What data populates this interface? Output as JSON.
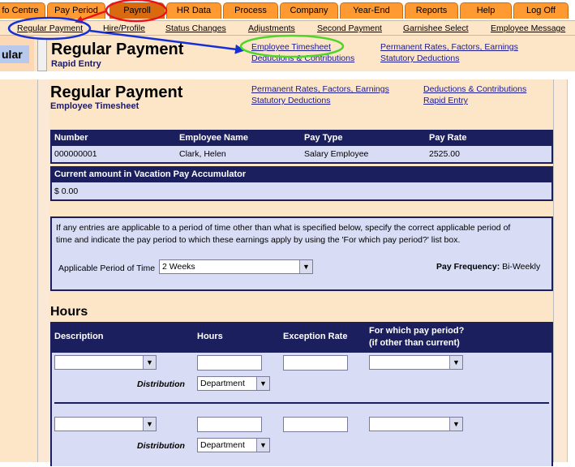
{
  "tabs": [
    {
      "label": "fo Centre",
      "active": false
    },
    {
      "label": "Pay Period",
      "active": false
    },
    {
      "label": "Payroll",
      "active": true
    },
    {
      "label": "HR Data",
      "active": false
    },
    {
      "label": "Process",
      "active": false
    },
    {
      "label": "Company",
      "active": false
    },
    {
      "label": "Year-End",
      "active": false
    },
    {
      "label": "Reports",
      "active": false
    },
    {
      "label": "Help",
      "active": false
    },
    {
      "label": "Log Off",
      "active": false
    }
  ],
  "subnav": [
    "Regular Payment",
    "Hire/Profile",
    "Status Changes",
    "Adjustments",
    "Second Payment",
    "Garnishee Select",
    "Employee Message"
  ],
  "top_page": {
    "side_label": "ular",
    "title": "Regular Payment",
    "subtitle": "Rapid Entry",
    "links": [
      "Employee Timesheet",
      "Deductions & Contributions",
      "Permanent Rates, Factors, Earnings",
      "Statutory Deductions"
    ]
  },
  "page": {
    "title": "Regular Payment",
    "subtitle": "Employee Timesheet",
    "links": [
      "Permanent Rates, Factors, Earnings",
      "Statutory Deductions",
      "Deductions & Contributions",
      "Rapid Entry"
    ]
  },
  "employee_table": {
    "headers": [
      "Number",
      "Employee Name",
      "Pay Type",
      "Pay Rate"
    ],
    "row": [
      "000000001",
      "Clark, Helen",
      "Salary Employee",
      "2525.00"
    ]
  },
  "vacation": {
    "header": "Current amount in Vacation Pay Accumulator",
    "value": "$ 0.00"
  },
  "period": {
    "info_line1": "If any entries are applicable to a period of time other than what is specified below, specify the correct applicable period of",
    "info_line2": "time and indicate the pay period to which these earnings apply by using the 'For which pay period?' list box.",
    "label": "Applicable Period of Time",
    "selected": "2 Weeks",
    "freq_label": "Pay Frequency:",
    "freq_value": "Bi-Weekly"
  },
  "hours": {
    "section_title": "Hours",
    "headers": [
      "Description",
      "Hours",
      "Exception Rate",
      "For which pay period?",
      "(if other than current)"
    ],
    "distribution_label": "Distribution",
    "distribution_value": "Department"
  },
  "annotation_colors": {
    "red": "#e8141b",
    "blue": "#1730d6",
    "green": "#4cd62a"
  }
}
